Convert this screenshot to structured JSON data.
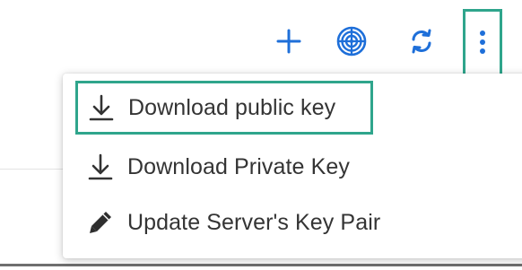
{
  "toolbar": {
    "icons": {
      "add": "plus-icon",
      "globe": "globe-icon",
      "refresh": "refresh-icon",
      "more": "more-vertical-icon"
    },
    "accent_color": "#1e6fd9",
    "highlight_color": "#2fa58c"
  },
  "menu": {
    "items": [
      {
        "label": "Download public key",
        "icon": "download-icon"
      },
      {
        "label": "Download Private Key",
        "icon": "download-icon"
      },
      {
        "label": "Update Server's Key Pair",
        "icon": "pencil-icon"
      }
    ]
  }
}
